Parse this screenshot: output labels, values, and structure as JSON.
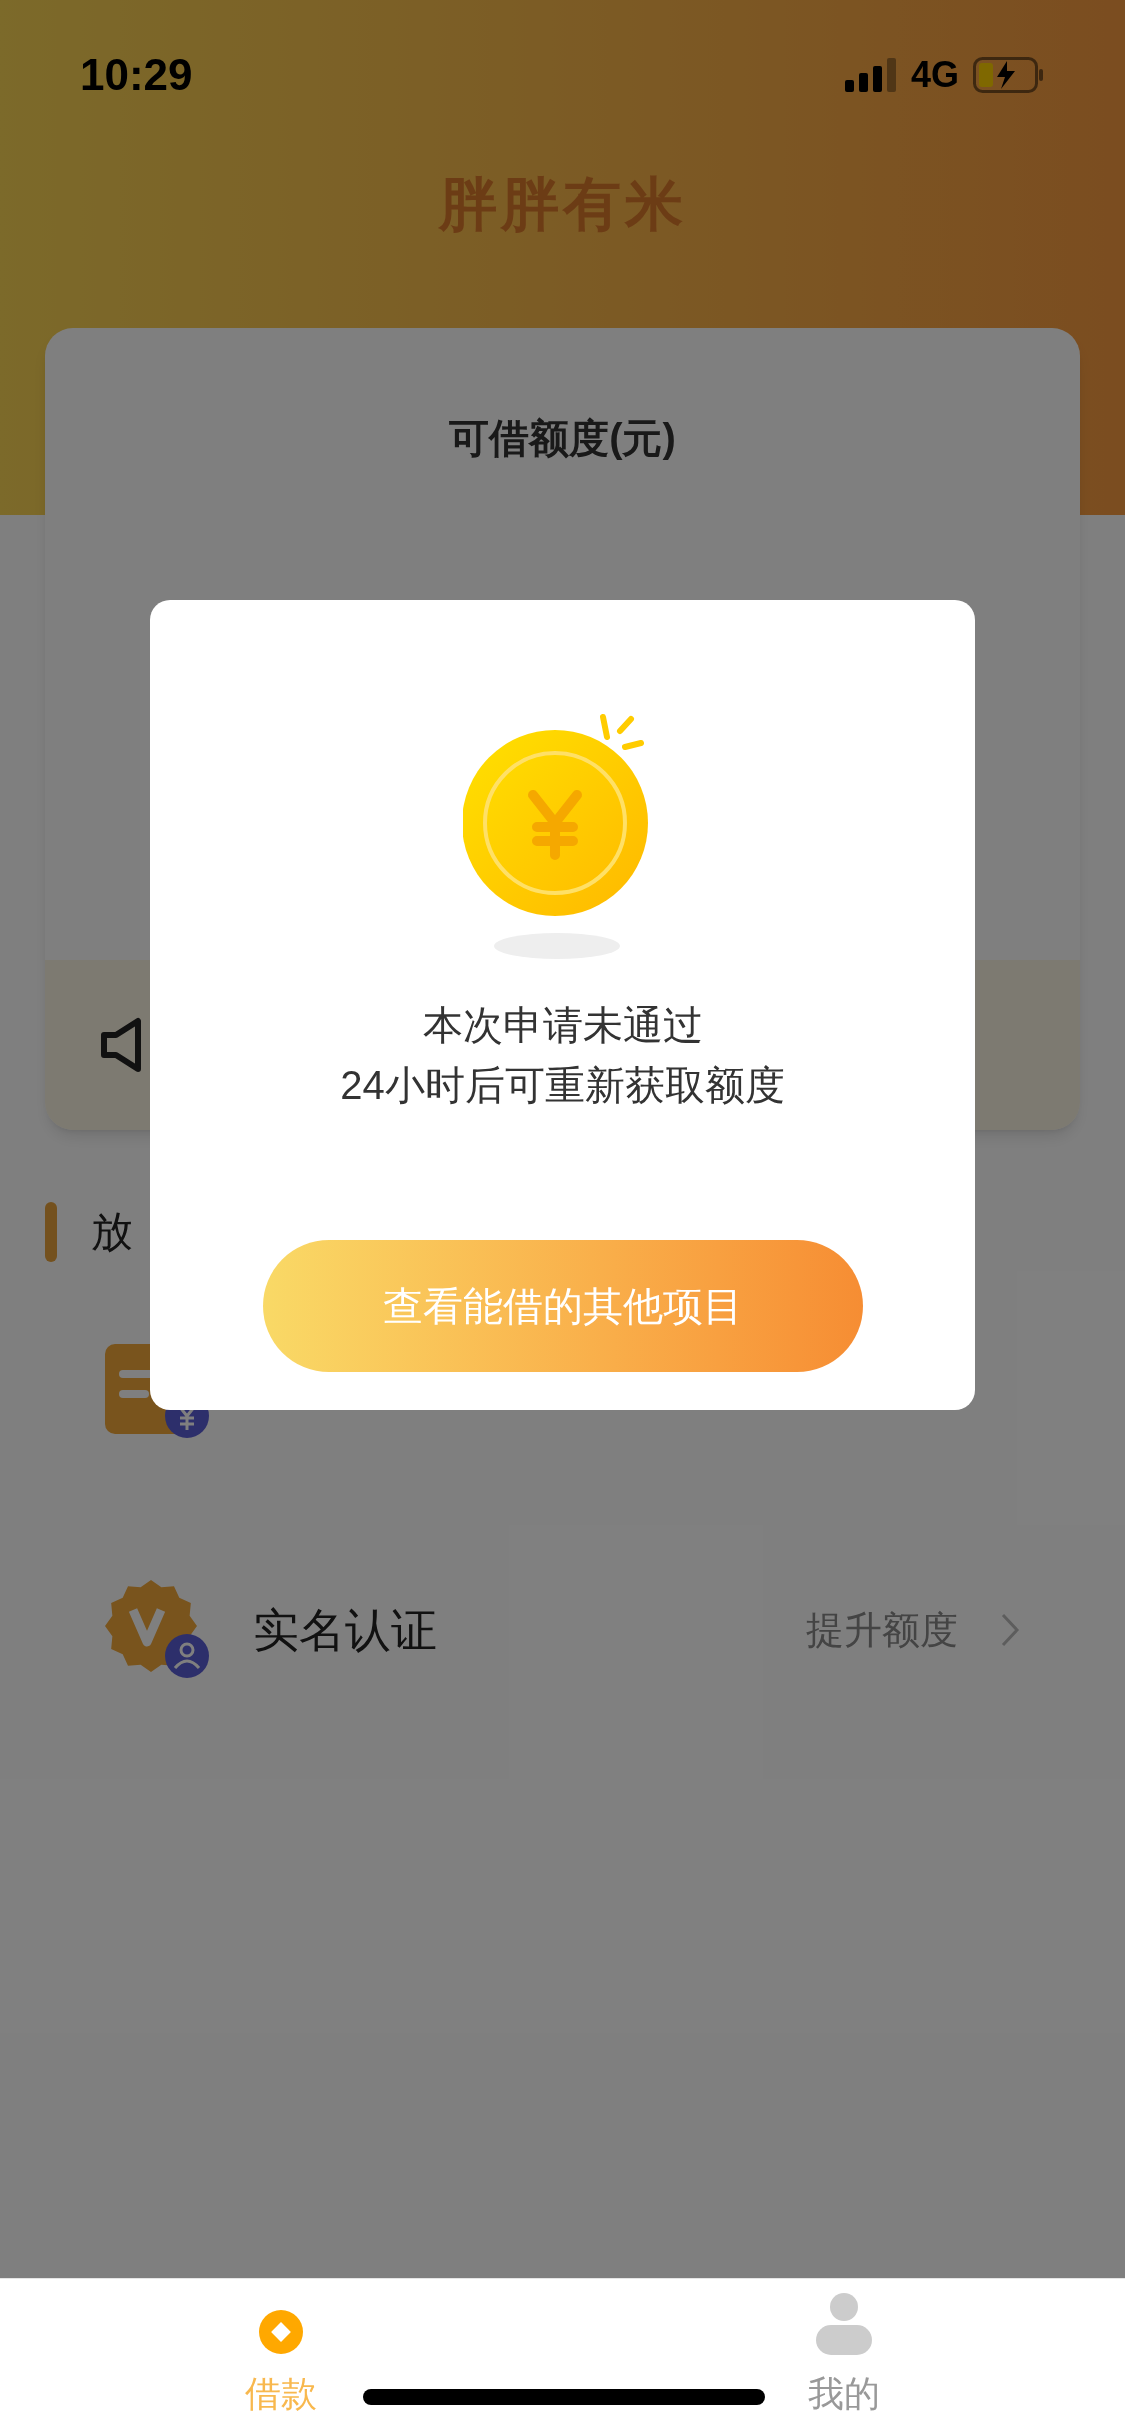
{
  "status_bar": {
    "time": "10:29",
    "network": "4G"
  },
  "header": {
    "title": "胖胖有米"
  },
  "credit_card": {
    "label": "可借额度(元)"
  },
  "section": {
    "title": "放"
  },
  "menu": [
    {
      "kind": "loans"
    },
    {
      "kind": "verify",
      "label": "实名认证",
      "action": "提升额度"
    }
  ],
  "dialog": {
    "message_lines": [
      "本次申请未通过",
      "24小时后可重新获取额度"
    ],
    "button": "查看能借的其他项目"
  },
  "tab_bar": [
    {
      "kind": "loan",
      "label": "借款",
      "selected": true
    },
    {
      "kind": "profile",
      "label": "我的",
      "selected": false
    }
  ]
}
